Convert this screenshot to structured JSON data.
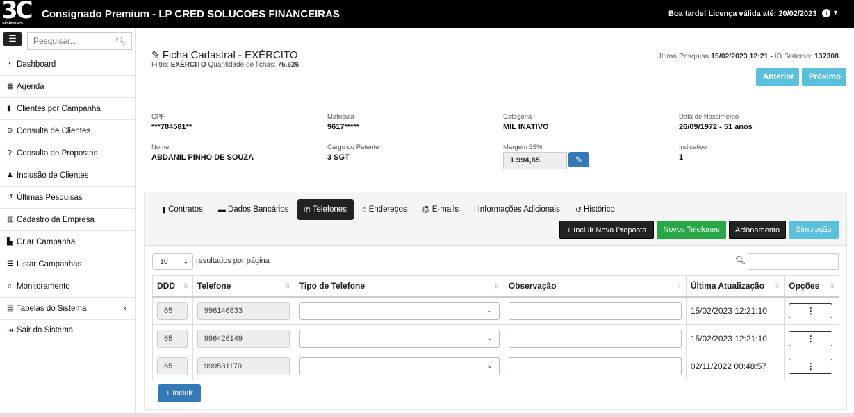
{
  "header": {
    "logo_big": "3C",
    "logo_small": "sistemas",
    "title": "Consignado Premium - LP CRED SOLUCOES FINANCEIRAS",
    "greeting": "Boa tarde! Licença válida até: 20/02/2023"
  },
  "sidebar": {
    "search_placeholder": "Pesquisar...",
    "items": [
      {
        "icon": "dashboard-icon",
        "label": "Dashboard"
      },
      {
        "icon": "calendar-icon",
        "label": "Agenda"
      },
      {
        "icon": "clipboard-icon",
        "label": "Clientes por Campanha"
      },
      {
        "icon": "search-plus-icon",
        "label": "Consulta de Clientes"
      },
      {
        "icon": "search-icon",
        "label": "Consulta de Propostas"
      },
      {
        "icon": "user-plus-icon",
        "label": "Inclusão de Clientes"
      },
      {
        "icon": "history-icon",
        "label": "Últimas Pesquisas"
      },
      {
        "icon": "building-icon",
        "label": "Cadastro da Empresa"
      },
      {
        "icon": "chart-icon",
        "label": "Criar Campanha"
      },
      {
        "icon": "list-icon",
        "label": "Listar Campanhas"
      },
      {
        "icon": "monitor-icon",
        "label": "Monitoramento"
      },
      {
        "icon": "table-icon",
        "label": "Tabelas do Sistema"
      },
      {
        "icon": "sign-out-icon",
        "label": "Sair do Sistema"
      }
    ]
  },
  "ficha": {
    "title": "Ficha Cadastral - EXÉRCITO",
    "filter_label": "Filtro:",
    "filter_value": "EXÉRCITO",
    "count_label": "Quantidade de fichas:",
    "count_value": "75.626",
    "last_search_label": "Ultima Pesquisa",
    "last_search_value": "15/02/2023 12:21",
    "system_id_label": "ID Sistema:",
    "system_id_value": "137308",
    "btn_prev": "Anterior",
    "btn_next": "Próximo"
  },
  "client": {
    "cpf_label": "CPF",
    "cpf": "***784581**",
    "matricula_label": "Matricula",
    "matricula": "9617*****",
    "categoria_label": "Categoria",
    "categoria": "MIL INATIVO",
    "nascimento_label": "Data de Nascimento",
    "nascimento": "26/09/1972 - 51 anos",
    "nome_label": "Nome",
    "nome": "ABDANIL PINHO DE SOUZA",
    "cargo_label": "Cargo ou Patente",
    "cargo": "3 SGT",
    "margem_label": "Margem 35%",
    "margem": "1.994,85",
    "indicativo_label": "Indicativo",
    "indicativo": "1"
  },
  "tabs": [
    {
      "icon": "file-icon",
      "label": "Contratos",
      "active": false
    },
    {
      "icon": "card-icon",
      "label": "Dados Bancários",
      "active": false
    },
    {
      "icon": "phone-icon",
      "label": "Telefones",
      "active": true
    },
    {
      "icon": "home-icon",
      "label": "Endereços",
      "active": false
    },
    {
      "icon": "at-icon",
      "label": "E-mails",
      "active": false
    },
    {
      "icon": "info-icon",
      "label": "Informações Adicionais",
      "active": false
    },
    {
      "icon": "history-icon",
      "label": "Histórico",
      "active": false
    }
  ],
  "actions": {
    "incluir_proposta": "+ Incluir Nova Proposta",
    "novos_telefones": "Novos Telefones",
    "acionamento": "Acionamento",
    "simulacao": "Simulação"
  },
  "table": {
    "per_page": "10",
    "per_page_text": "resultados por página",
    "columns": [
      "DDD",
      "Telefone",
      "Tipo de Telefone",
      "Observação",
      "Última Atualização",
      "Opções"
    ],
    "rows": [
      {
        "ddd": "65",
        "telefone": "996146833",
        "updated": "15/02/2023 12:21:10"
      },
      {
        "ddd": "65",
        "telefone": "996426149",
        "updated": "15/02/2023 12:21:10"
      },
      {
        "ddd": "65",
        "telefone": "999531179",
        "updated": "02/11/2022 00:48:57"
      }
    ],
    "options_glyph": "⋮",
    "incluir": "+ Incluir"
  }
}
